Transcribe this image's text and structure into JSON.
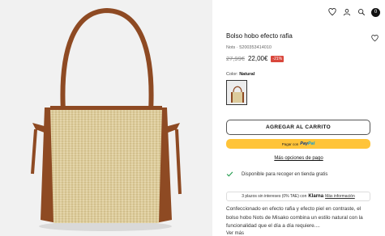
{
  "header": {
    "icons": [
      "heart-icon",
      "user-icon",
      "search-icon",
      "bag-icon"
    ],
    "cart_count": "0"
  },
  "product": {
    "title": "Bolso hobo efecto rafia",
    "sku": "Nots · 5200353414010",
    "old_price": "27,99€",
    "price": "22,00€",
    "discount": "-21%",
    "color_label": "Color:",
    "color_value": "Natural"
  },
  "actions": {
    "add_to_cart": "AGREGAR AL CARRITO",
    "paypal_prefix": "Pagar con",
    "paypal_brand_a": "Pay",
    "paypal_brand_b": "Pal",
    "more_payment": "Más opciones de pago"
  },
  "availability": {
    "text": "Disponible para recoger en tienda gratis"
  },
  "klarna": {
    "text": "3 plazos sin intereses (0% TAE) con",
    "brand": "Klarna",
    "link": "Más información"
  },
  "description": {
    "text": "Confeccionado en efecto rafia y efecto piel en contraste, el bolso hobo Nots de Misako combina un estilo natural con la funcionalidad que el día a día requiere....",
    "more": "Ver más"
  },
  "colors": {
    "raffia": "#dccb9c",
    "leather": "#8e4a23",
    "accent_check": "#1e9a4a",
    "discount": "#d9473c",
    "paypal": "#ffc439"
  }
}
